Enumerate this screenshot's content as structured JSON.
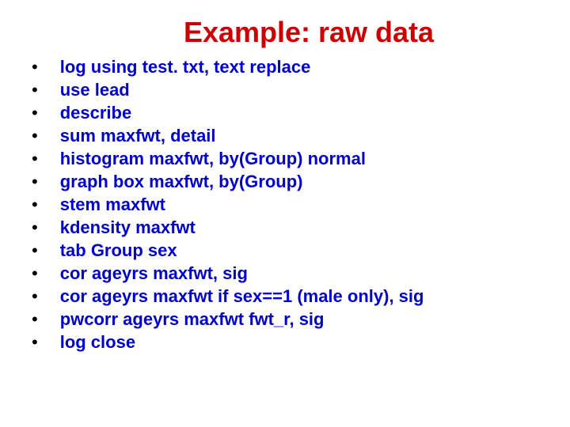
{
  "title": "Example: raw data",
  "bullets": [
    "log using test. txt, text replace",
    "use lead",
    "describe",
    "sum maxfwt, detail",
    "histogram maxfwt, by(Group) normal",
    "graph box maxfwt, by(Group)",
    "stem maxfwt",
    "kdensity maxfwt",
    "tab Group sex",
    "cor ageyrs maxfwt, sig",
    "cor ageyrs maxfwt if sex==1 (male only), sig",
    "pwcorr ageyrs maxfwt fwt_r, sig",
    "log close"
  ]
}
